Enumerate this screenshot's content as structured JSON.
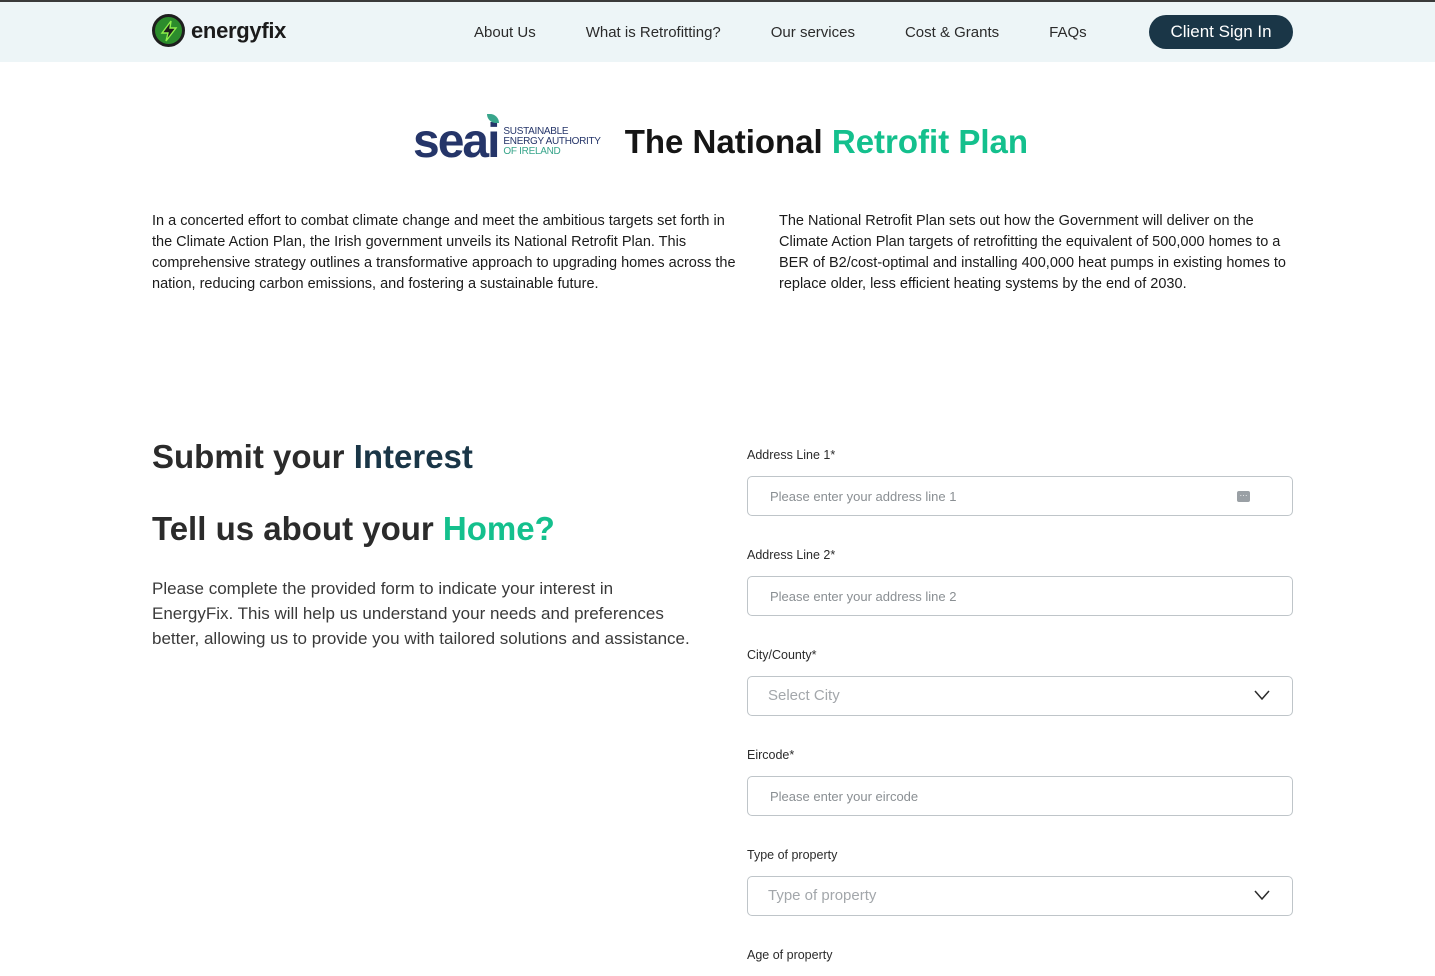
{
  "header": {
    "brand": "energyfix",
    "nav": [
      {
        "label": "About Us"
      },
      {
        "label": "What is Retrofitting?"
      },
      {
        "label": "Our services"
      },
      {
        "label": "Cost & Grants"
      },
      {
        "label": "FAQs"
      }
    ],
    "signin_label": "Client Sign In"
  },
  "plan": {
    "seai_logo": {
      "word": "seai",
      "line1": "SUSTAINABLE",
      "line2": "ENERGY AUTHORITY",
      "line3": "OF IRELAND"
    },
    "title_main": "The National ",
    "title_accent": "Retrofit Plan",
    "para_left": "In a concerted effort to combat climate change and meet the ambitious targets set forth in the Climate Action Plan, the Irish government unveils its National Retrofit Plan. This comprehensive strategy outlines a transformative approach to upgrading homes across the nation, reducing carbon emissions, and fostering a sustainable future.",
    "para_right": "The National Retrofit Plan sets out how the Government will deliver on the Climate Action Plan targets of retrofitting the equivalent of 500,000 homes to a BER of B2/cost-optimal and installing 400,000 heat pumps in existing homes to replace older, less efficient heating systems by the end of 2030."
  },
  "interest": {
    "submit_main": "Submit your ",
    "submit_accent": "Interest",
    "home_main": "Tell us about your ",
    "home_accent": "Home?",
    "lead": "Please complete the provided form to indicate your interest in EnergyFix. This will help us understand your needs and preferences better, allowing us to provide you with tailored solutions and assistance."
  },
  "form": {
    "address1": {
      "label": "Address Line 1*",
      "placeholder": "Please enter your address line 1",
      "value": ""
    },
    "address2": {
      "label": "Address Line 2*",
      "placeholder": "Please enter your address line 2",
      "value": ""
    },
    "city": {
      "label": "City/County*",
      "selected": "Select City"
    },
    "eircode": {
      "label": "Eircode*",
      "placeholder": "Please enter your eircode",
      "value": ""
    },
    "property_type": {
      "label": "Type of property",
      "selected": "Type of property"
    },
    "property_age": {
      "label": "Age of property"
    }
  },
  "colors": {
    "brand_dark": "#1a3647",
    "accent_green": "#14c08d",
    "header_bg": "#edf5f7",
    "logo_green": "#2c8c2c"
  },
  "icons": {
    "logo": "lightning-bolt-icon",
    "autofill": "autofill-icon",
    "select": "chevron-down-icon"
  }
}
